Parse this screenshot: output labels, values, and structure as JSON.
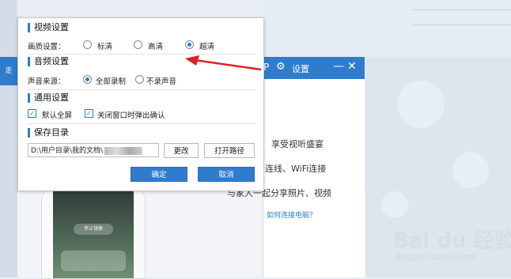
{
  "background": {
    "left_strip_text": "走",
    "win2": {
      "title_prefix": "P",
      "title": "设置",
      "lines": [
        "享受视听盛宴",
        "连线、WiFi连接",
        "与家人一起分享照片、视频"
      ],
      "link": "如何连接电脑？"
    },
    "phone_pill": "停止镜像"
  },
  "dialog": {
    "video": {
      "title": "视频设置",
      "quality_label": "画质设置：",
      "options": [
        "标清",
        "高清",
        "超清"
      ],
      "selected": "超清"
    },
    "audio": {
      "title": "音频设置",
      "source_label": "声音来源：",
      "options": [
        "全部录制",
        "不录声音"
      ],
      "selected": "全部录制"
    },
    "general": {
      "title": "通用设置",
      "checks": [
        {
          "label": "默认全屏",
          "checked": true
        },
        {
          "label": "关闭窗口时弹出确认",
          "checked": true
        }
      ]
    },
    "save": {
      "title": "保存目录",
      "path": "D:\\用户目录\\我的文档\\",
      "change_label": "更改",
      "open_label": "打开路径"
    },
    "confirm_label": "确定",
    "cancel_label": "取消"
  },
  "watermark": {
    "logo": "Bai du 经验",
    "url": "jingyan.baidu.com"
  },
  "colors": {
    "accent": "#2f7ccd",
    "arrow": "#e02020"
  }
}
